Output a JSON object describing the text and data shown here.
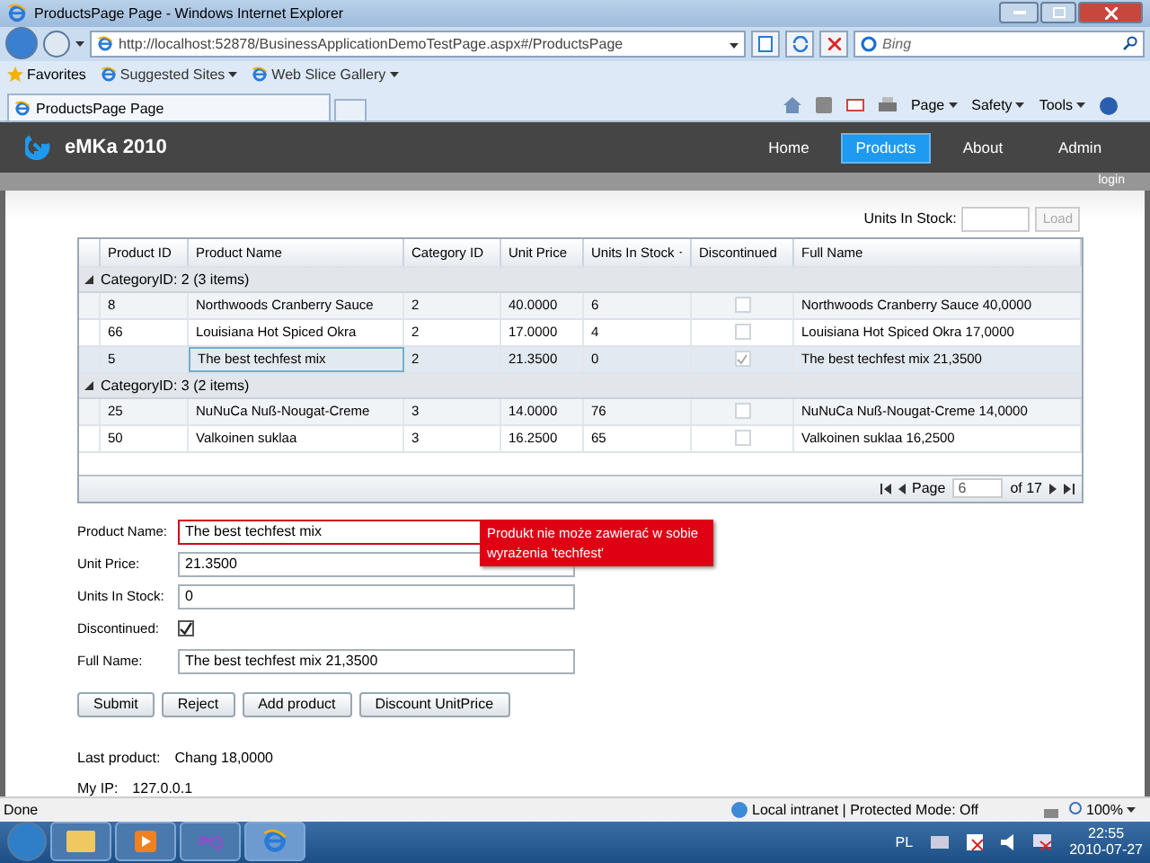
{
  "browser": {
    "title": "ProductsPage Page - Windows Internet Explorer",
    "address": "http://localhost:52878/BusinessApplicationDemoTestPage.aspx#/ProductsPage",
    "search_placeholder": "Bing",
    "favorites": [
      "Favorites",
      "Suggested Sites",
      "Web Slice Gallery"
    ],
    "tab": "ProductsPage Page",
    "commands": [
      "Page",
      "Safety",
      "Tools"
    ]
  },
  "app": {
    "brand": "eMKa 2010",
    "nav": [
      {
        "label": "Home",
        "selected": false
      },
      {
        "label": "Products",
        "selected": true
      },
      {
        "label": "About",
        "selected": false
      },
      {
        "label": "Admin",
        "selected": false
      }
    ],
    "login": "login"
  },
  "stock_filter": {
    "label": "Units In Stock:",
    "button": "Load"
  },
  "grid": {
    "columns": [
      {
        "label": "Product ID",
        "sorted": false
      },
      {
        "label": "Product Name",
        "sorted": false
      },
      {
        "label": "Category ID",
        "sorted": false
      },
      {
        "label": "Unit Price",
        "sorted": false
      },
      {
        "label": "Units In Stock",
        "sorted": true
      },
      {
        "label": "Discontinued",
        "sorted": false
      },
      {
        "label": "Full Name",
        "sorted": false
      }
    ],
    "groups": [
      {
        "header": "CategoryID: 2 (3 items)",
        "expanded": true,
        "rows": [
          {
            "cells": [
              "8",
              "Northwoods Cranberry Sauce",
              "2",
              "40.0000",
              "6"
            ],
            "discontinued": false,
            "full_name": "Northwoods Cranberry Sauce 40,0000",
            "selected": false
          },
          {
            "cells": [
              "66",
              "Louisiana Hot Spiced Okra",
              "2",
              "17.0000",
              "4"
            ],
            "discontinued": false,
            "full_name": "Louisiana Hot Spiced Okra 17,0000",
            "selected": false
          },
          {
            "cells": [
              "5",
              "The best techfest mix",
              "2",
              "21.3500",
              "0"
            ],
            "discontinued": true,
            "full_name": "The best techfest mix 21,3500",
            "selected": true
          }
        ]
      },
      {
        "header": "CategoryID: 3 (2 items)",
        "expanded": true,
        "rows": [
          {
            "cells": [
              "25",
              "NuNuCa Nuß-Nougat-Creme",
              "3",
              "14.0000",
              "76"
            ],
            "discontinued": false,
            "full_name": "NuNuCa Nuß-Nougat-Creme 14,0000",
            "selected": false
          },
          {
            "cells": [
              "50",
              "Valkoinen suklaa",
              "3",
              "16.2500",
              "65"
            ],
            "discontinued": false,
            "full_name": "Valkoinen suklaa 16,2500",
            "selected": false
          }
        ]
      }
    ],
    "pager": {
      "label": "Page",
      "value": "6",
      "total": "of 17"
    }
  },
  "form": {
    "fields": [
      {
        "kind": "text",
        "label": "Product Name:",
        "value": "The best techfest mix",
        "invalid": true
      },
      {
        "kind": "text",
        "label": "Unit Price:",
        "value": "21.3500",
        "invalid": false
      },
      {
        "kind": "text",
        "label": "Units In Stock:",
        "value": "0",
        "invalid": false
      },
      {
        "kind": "checkbox",
        "label": "Discontinued:",
        "checked": true
      },
      {
        "kind": "text",
        "label": "Full Name:",
        "value": "The best techfest mix 21,3500",
        "invalid": false
      }
    ],
    "error": "Produkt nie może zawierać w sobie wyrażenia 'techfest'",
    "buttons": [
      "Submit",
      "Reject",
      "Add product",
      "Discount UnitPrice"
    ]
  },
  "info": [
    {
      "label": "Last product:",
      "value": "Chang 18,0000"
    },
    {
      "label": "My IP:",
      "value": "127.0.0.1"
    }
  ],
  "status_bar": {
    "text": "Done",
    "zone": "Local intranet | Protected Mode: Off",
    "zoom": "100%"
  },
  "taskbar": {
    "language": "PL",
    "time": "22:55",
    "date": "2010-07-27"
  }
}
